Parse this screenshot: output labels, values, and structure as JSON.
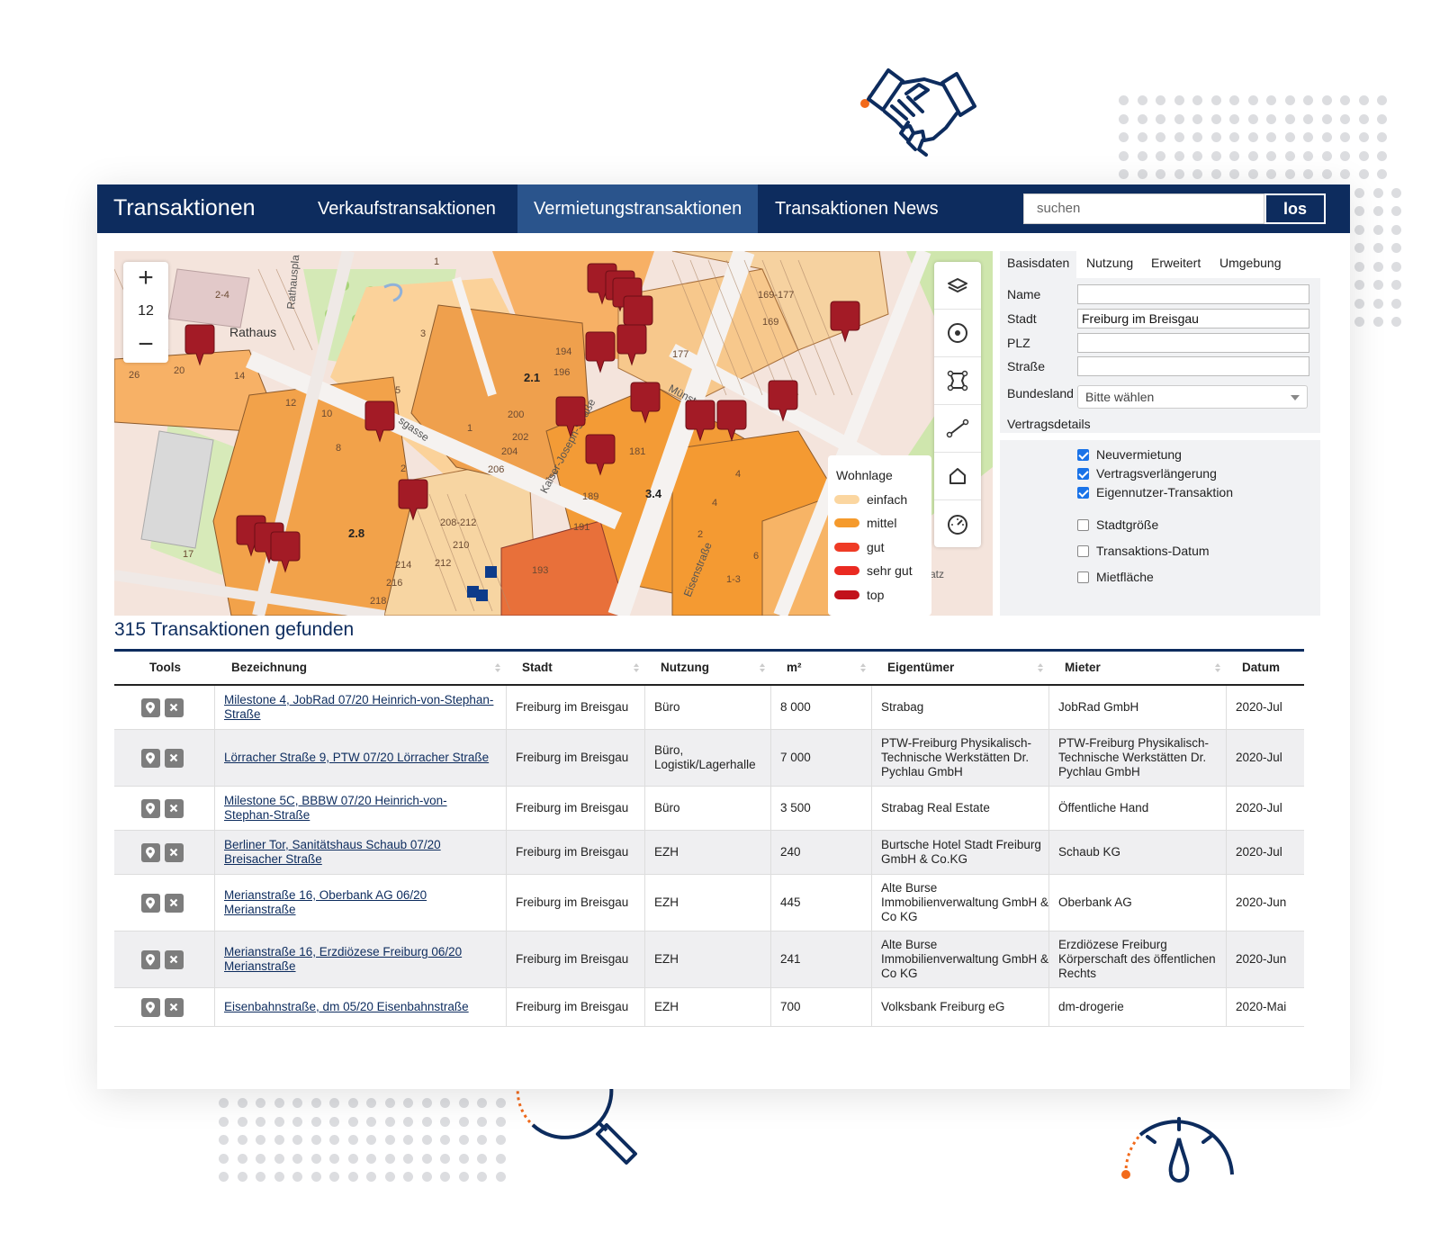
{
  "app": {
    "brand": "Transaktionen",
    "nav": [
      {
        "label": "Verkaufstransaktionen",
        "active": false
      },
      {
        "label": "Vermietungstransaktionen",
        "active": true
      },
      {
        "label": "Transaktionen News",
        "active": false
      }
    ],
    "search": {
      "placeholder": "suchen",
      "button": "los"
    }
  },
  "map": {
    "zoom_level": "12",
    "zoom_in": "+",
    "zoom_out": "−",
    "labels": {
      "rathaus": "Rathaus",
      "a": "2.1",
      "b": "3.4",
      "c": "2.8",
      "street1": "Kaiser-Joseph-Straße",
      "street2": "Eisenstraße",
      "street3": "Münst",
      "street4": "sgasse",
      "platz": "erplatz",
      "n169": "169-177",
      "n169b": "169",
      "n194": "194",
      "n196": "196",
      "n177": "177",
      "n181": "181",
      "n189": "189",
      "n191": "191",
      "n193": "193",
      "n200": "200",
      "n202": "202",
      "n204": "204",
      "n206": "206",
      "n208": "208-212",
      "n210": "210",
      "n212": "212",
      "n214": "214",
      "n216": "216",
      "n218": "218",
      "n3": "3",
      "n1": "1",
      "n12": "12",
      "n10": "10",
      "n8": "8",
      "n14": "14",
      "n26": "26",
      "n20": "20",
      "n17": "17",
      "n4": "4",
      "n5": "5",
      "n2": "2",
      "n6": "6",
      "n13": "1-3",
      "n24": "2-4",
      "rp": "Rathauspla"
    },
    "legend": {
      "title": "Wohnlage",
      "items": [
        {
          "label": "einfach",
          "color": "#fbd6a0"
        },
        {
          "label": "mittel",
          "color": "#f59a2c"
        },
        {
          "label": "gut",
          "color": "#ef3b26"
        },
        {
          "label": "sehr gut",
          "color": "#ea2a21"
        },
        {
          "label": "top",
          "color": "#c2121b"
        }
      ]
    }
  },
  "filters": {
    "tabs": [
      "Basisdaten",
      "Nutzung",
      "Erweitert",
      "Umgebung"
    ],
    "fields": [
      {
        "label": "Name",
        "value": ""
      },
      {
        "label": "Stadt",
        "value": "Freiburg im Breisgau"
      },
      {
        "label": "PLZ",
        "value": ""
      },
      {
        "label": "Straße",
        "value": ""
      }
    ],
    "bundesland": {
      "label": "Bundesland",
      "value": "Bitte wählen"
    },
    "section": "Vertragsdetails",
    "checkboxes": [
      {
        "label": "Neuvermietung",
        "checked": true
      },
      {
        "label": "Vertragsverlängerung",
        "checked": true
      },
      {
        "label": "Eigennutzer-Transaktion",
        "checked": true
      },
      {
        "label": "Stadtgröße",
        "checked": false
      },
      {
        "label": "Transaktions-Datum",
        "checked": false
      },
      {
        "label": "Mietfläche",
        "checked": false
      }
    ]
  },
  "results": {
    "count_text": "315 Transaktionen gefunden",
    "columns": [
      "Tools",
      "Bezeichnung",
      "Stadt",
      "Nutzung",
      "m²",
      "Eigentümer",
      "Mieter",
      "Datum"
    ],
    "rows": [
      {
        "bezeichnung": "Milestone 4, JobRad 07/20 Heinrich-von-Stephan-Straße",
        "stadt": "Freiburg im Breisgau",
        "nutzung": "Büro",
        "m2": "8 000",
        "eigentuemer": "Strabag",
        "mieter": "JobRad GmbH",
        "datum": "2020-Jul"
      },
      {
        "bezeichnung": "Lörracher Straße 9, PTW 07/20 Lörracher Straße",
        "stadt": "Freiburg im Breisgau",
        "nutzung": "Büro, Logistik/Lagerhalle",
        "m2": "7 000",
        "eigentuemer": "PTW-Freiburg Physikalisch-Technische Werkstätten Dr. Pychlau GmbH",
        "mieter": "PTW-Freiburg Physikalisch-Technische Werkstätten Dr. Pychlau GmbH",
        "datum": "2020-Jul"
      },
      {
        "bezeichnung": "Milestone 5C, BBBW 07/20 Heinrich-von-Stephan-Straße",
        "stadt": "Freiburg im Breisgau",
        "nutzung": "Büro",
        "m2": "3 500",
        "eigentuemer": "Strabag Real Estate",
        "mieter": "Öffentliche Hand",
        "datum": "2020-Jul"
      },
      {
        "bezeichnung": "Berliner Tor, Sanitätshaus Schaub 07/20 Breisacher Straße",
        "stadt": "Freiburg im Breisgau",
        "nutzung": "EZH",
        "m2": "240",
        "eigentuemer": "Burtsche Hotel Stadt Freiburg GmbH & Co.KG",
        "mieter": "Schaub KG",
        "datum": "2020-Jul"
      },
      {
        "bezeichnung": "Merianstraße 16, Oberbank AG 06/20 Merianstraße",
        "stadt": "Freiburg im Breisgau",
        "nutzung": "EZH",
        "m2": "445",
        "eigentuemer": "Alte Burse Immobilienverwaltung GmbH & Co KG",
        "mieter": "Oberbank AG",
        "datum": "2020-Jun"
      },
      {
        "bezeichnung": "Merianstraße 16, Erzdiözese Freiburg 06/20 Merianstraße",
        "stadt": "Freiburg im Breisgau",
        "nutzung": "EZH",
        "m2": "241",
        "eigentuemer": "Alte Burse Immobilienverwaltung GmbH & Co KG",
        "mieter": "Erzdiözese Freiburg Körperschaft des öffentlichen Rechts",
        "datum": "2020-Jun"
      },
      {
        "bezeichnung": "Eisenbahnstraße, dm 05/20 Eisenbahnstraße",
        "stadt": "Freiburg im Breisgau",
        "nutzung": "EZH",
        "m2": "700",
        "eigentuemer": "Volksbank Freiburg eG",
        "mieter": "dm-drogerie",
        "datum": "2020-Mai"
      }
    ]
  },
  "colors": {
    "primary": "#0d2c5e",
    "nav_active": "#2a548c",
    "accent": "#f26a1b",
    "marker": "#a31b26"
  },
  "icons": [
    "handshake-icon",
    "magnifier-icon",
    "gauge-icon",
    "layers-icon",
    "target-icon",
    "polygon-icon",
    "line-icon",
    "home-icon",
    "speed-icon",
    "pin-icon",
    "close-icon",
    "caret-down-icon",
    "sort-icon"
  ]
}
